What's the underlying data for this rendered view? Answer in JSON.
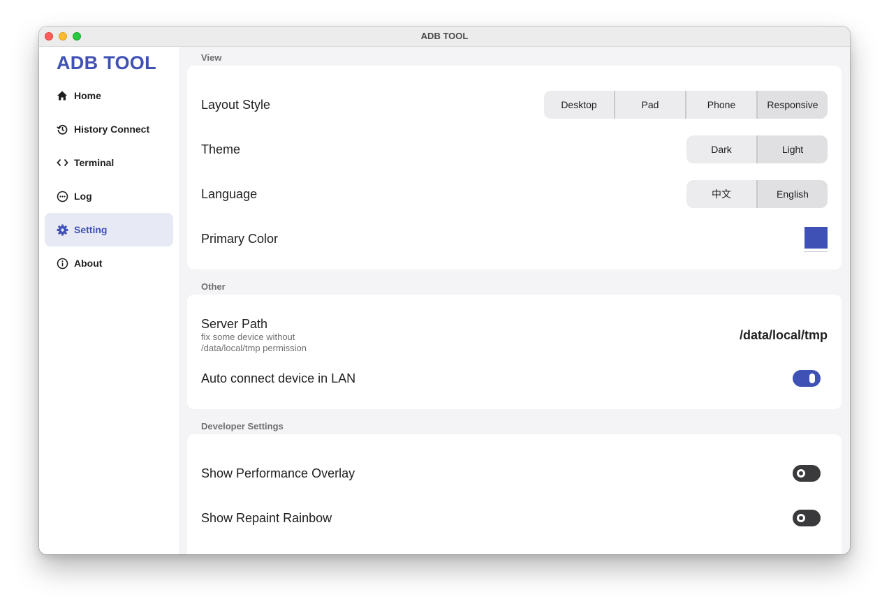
{
  "window": {
    "title": "ADB TOOL"
  },
  "sidebar": {
    "brand": "ADB TOOL",
    "items": [
      {
        "label": "Home",
        "icon": "home-icon",
        "active": false
      },
      {
        "label": "History Connect",
        "icon": "history-icon",
        "active": false
      },
      {
        "label": "Terminal",
        "icon": "code-icon",
        "active": false
      },
      {
        "label": "Log",
        "icon": "log-icon",
        "active": false
      },
      {
        "label": "Setting",
        "icon": "gear-icon",
        "active": true
      },
      {
        "label": "About",
        "icon": "info-icon",
        "active": false
      }
    ]
  },
  "sections": {
    "view": {
      "title": "View",
      "layout_style": {
        "label": "Layout Style",
        "options": [
          "Desktop",
          "Pad",
          "Phone",
          "Responsive"
        ],
        "selected": "Responsive"
      },
      "theme": {
        "label": "Theme",
        "options": [
          "Dark",
          "Light"
        ],
        "selected": "Light"
      },
      "language": {
        "label": "Language",
        "options": [
          "中文",
          "English"
        ],
        "selected": "English"
      },
      "primary_color": {
        "label": "Primary Color",
        "value": "#3f51b5"
      }
    },
    "other": {
      "title": "Other",
      "server_path": {
        "label": "Server Path",
        "sub_line1": "fix some device without",
        "sub_line2": "/data/local/tmp permission",
        "value": "/data/local/tmp"
      },
      "auto_connect": {
        "label": "Auto connect device in LAN",
        "enabled": true
      }
    },
    "developer": {
      "title": "Developer Settings",
      "performance_overlay": {
        "label": "Show Performance Overlay",
        "enabled": false
      },
      "repaint_rainbow": {
        "label": "Show Repaint Rainbow",
        "enabled": false
      }
    }
  },
  "colors": {
    "accent": "#3f51b5",
    "toggle_off": "#3a3a3c",
    "sidebar_active_bg": "#e7e9f5"
  }
}
